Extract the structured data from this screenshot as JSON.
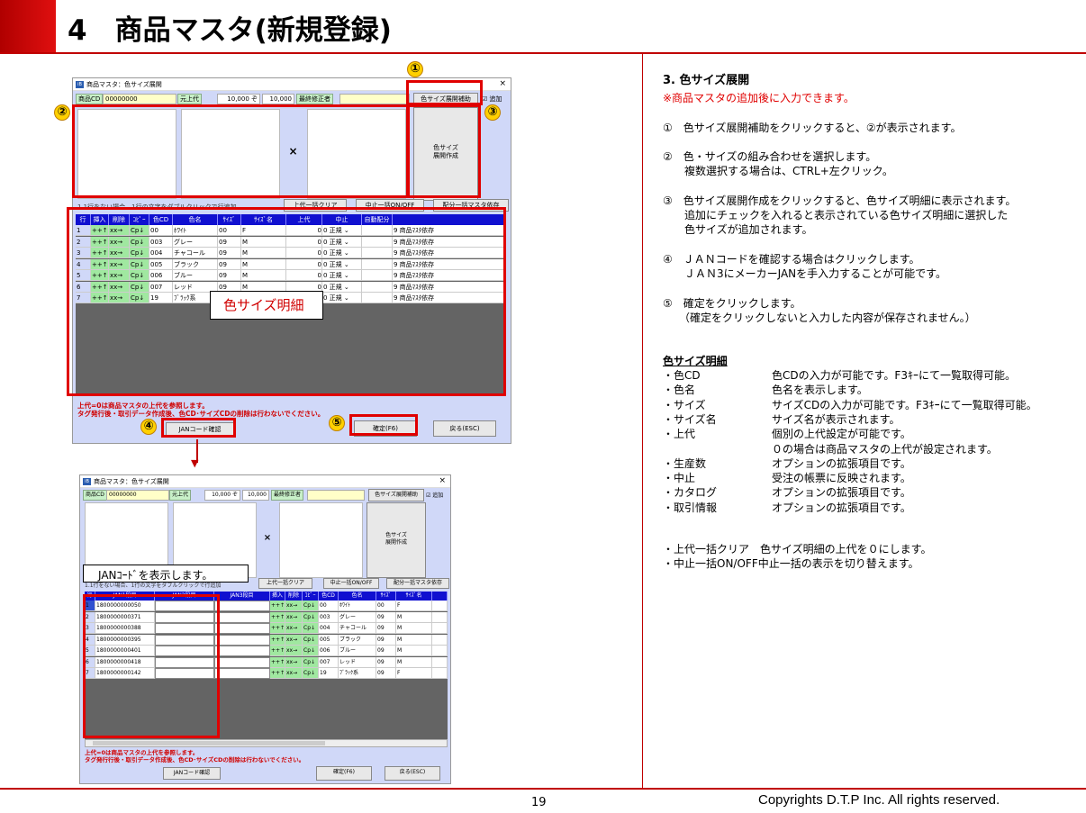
{
  "header": {
    "title": "4　商品マスタ(新規登録)"
  },
  "footer": {
    "page": "19",
    "copyright": "Copyrights  D.T.P Inc. All rights reserved."
  },
  "win1": {
    "title": "商品マスタ：色サイズ展開",
    "close": "×",
    "code_label": "商品CD",
    "code_value": "00000000",
    "price_label": "元上代",
    "price1": "10,000 ぞ",
    "price2": "10,000",
    "editor_label": "最終修正者",
    "expand_help_btn": "色サイズ展開補助",
    "add_check": "☑ 追加",
    "times": "×",
    "create_btn": "色サイズ\n展開作成",
    "hint": "1.1行をない場合、1行の文字をダブルクリックで行追加",
    "clear_btn": "上代一括クリア",
    "toggle_btn": "中止一括ON/OFF",
    "master_btn": "配分一括マスタ依存",
    "headers": [
      "行",
      "挿入",
      "削除",
      "ｺﾋﾟｰ",
      "色CD",
      "色名",
      "ｻｲｽﾞ",
      "ｻｲｽﾞ名",
      "上代",
      "中止",
      "自動配分"
    ],
    "rows": [
      {
        "n": "1",
        "ins": "++↑",
        "del": "xx→",
        "cp": "Cp↓",
        "cd": "00",
        "name": "ﾎﾜｲﾄ",
        "size": "00",
        "sname": "F",
        "price": "0",
        "stop": "0 正規 ⌄",
        "dist": "9 商品ﾏｽﾀ依存"
      },
      {
        "n": "2",
        "ins": "++↑",
        "del": "xx→",
        "cp": "Cp↓",
        "cd": "003",
        "name": "グレー",
        "size": "09",
        "sname": "M",
        "price": "0",
        "stop": "0 正規 ⌄",
        "dist": "9 商品ﾏｽﾀ依存"
      },
      {
        "n": "3",
        "ins": "++↑",
        "del": "xx→",
        "cp": "Cp↓",
        "cd": "004",
        "name": "チャコール",
        "size": "09",
        "sname": "M",
        "price": "0",
        "stop": "0 正規 ⌄",
        "dist": "9 商品ﾏｽﾀ依存"
      },
      {
        "n": "4",
        "ins": "++↑",
        "del": "xx→",
        "cp": "Cp↓",
        "cd": "005",
        "name": "ブラック",
        "size": "09",
        "sname": "M",
        "price": "0",
        "stop": "0 正規 ⌄",
        "dist": "9 商品ﾏｽﾀ依存"
      },
      {
        "n": "5",
        "ins": "++↑",
        "del": "xx→",
        "cp": "Cp↓",
        "cd": "006",
        "name": "ブルー",
        "size": "09",
        "sname": "M",
        "price": "0",
        "stop": "0 正規 ⌄",
        "dist": "9 商品ﾏｽﾀ依存"
      },
      {
        "n": "6",
        "ins": "++↑",
        "del": "xx→",
        "cp": "Cp↓",
        "cd": "007",
        "name": "レッド",
        "size": "09",
        "sname": "M",
        "price": "0",
        "stop": "0 正規 ⌄",
        "dist": "9 商品ﾏｽﾀ依存"
      },
      {
        "n": "7",
        "ins": "++↑",
        "del": "xx→",
        "cp": "Cp↓",
        "cd": "19",
        "name": "ﾌﾞﾗｯｸ系",
        "size": "09",
        "sname": "M",
        "price": "0",
        "stop": "0 正規 ⌄",
        "dist": "9 商品ﾏｽﾀ依存"
      }
    ],
    "grid_note": "色サイズ明細",
    "warn1": "上代=0は商品マスタの上代を参照します。",
    "warn2": "タグ発行後・取引データ作成後、色CD･サイズCDの削除は行わないでください。",
    "jan_btn": "JANコード確認",
    "ok_btn": "確定(F6)",
    "back_btn": "戻る(ESC)"
  },
  "win2": {
    "title": "商品マスタ：色サイズ展開",
    "close": "×",
    "code_label": "商品CD",
    "code_value": "00000000",
    "price_label": "元上代",
    "price1": "10,000 ぞ",
    "price2": "10,000",
    "editor_label": "最終修正者",
    "expand_help_btn": "色サイズ展開補助",
    "add_check": "☑ 追加",
    "times": "×",
    "create_btn": "色サイズ\n展開作成",
    "hint": "1.1行をない場合、1行の文字をダブルクリックで行追加",
    "clear_btn": "上代一括クリア",
    "toggle_btn": "中止一括ON/OFF",
    "master_btn": "配分一括マスタ依存",
    "headers": [
      "行",
      "JAN1段目",
      "JAN2段目",
      "JAN3段目",
      "挿入",
      "削除",
      "ｺﾋﾟｰ",
      "色CD",
      "色名",
      "ｻｲｽﾞ",
      "ｻｲｽﾞ名"
    ],
    "rows": [
      {
        "n": "1",
        "jan": "1800000000050",
        "cd": "00",
        "name": "ﾎﾜｲﾄ",
        "size": "00",
        "sname": "F"
      },
      {
        "n": "2",
        "jan": "1800000000371",
        "cd": "003",
        "name": "グレー",
        "size": "09",
        "sname": "M"
      },
      {
        "n": "3",
        "jan": "1800000000388",
        "cd": "004",
        "name": "チャコール",
        "size": "09",
        "sname": "M"
      },
      {
        "n": "4",
        "jan": "1800000000395",
        "cd": "005",
        "name": "ブラック",
        "size": "09",
        "sname": "M"
      },
      {
        "n": "5",
        "jan": "1800000000401",
        "cd": "006",
        "name": "ブルー",
        "size": "09",
        "sname": "M"
      },
      {
        "n": "6",
        "jan": "1800000000418",
        "cd": "007",
        "name": "レッド",
        "size": "09",
        "sname": "M"
      },
      {
        "n": "7",
        "jan": "1800000000142",
        "cd": "19",
        "name": "ﾌﾞﾗｯｸ系",
        "size": "09",
        "sname": "F"
      }
    ],
    "btn_ins": "++↑",
    "btn_del": "xx→",
    "btn_cp": "Cp↓",
    "note": "JANｺｰﾄﾞを表示します。",
    "warn1": "上代=0は商品マスタの上代を参照します。",
    "warn2": "タグ発行行後・取引データ作成後、色CD･サイズCDの削除は行わないでください。",
    "jan_btn": "JANコード確認",
    "ok_btn": "確定(F6)",
    "back_btn": "戻る(ESC)"
  },
  "markers": {
    "m1": "①",
    "m2": "②",
    "m3": "③",
    "m4": "④",
    "m5": "⑤"
  },
  "arrow": "▼",
  "right": {
    "section_title": "3. 色サイズ展開",
    "section_note": "※商品マスタの追加後に入力できます。",
    "step1": "①　色サイズ展開補助をクリックすると、②が表示されます。",
    "step2a": "②　色・サイズの組み合わせを選択します。",
    "step2b": "　　複数選択する場合は、CTRL+左クリック。",
    "step3a": "③　色サイズ展開作成をクリックすると、色サイズ明細に表示されます。",
    "step3b": "　　追加にチェックを入れると表示されている色サイズ明細に選択した",
    "step3c": "　　色サイズが追加されます。",
    "step4a": "④　ＪＡＮコードを確認する場合はクリックします。",
    "step4b": "　　ＪＡＮ3にメーカーJANを手入力することが可能です。",
    "step5a": "⑤　確定をクリックします。",
    "step5b": "　　（確定をクリックしないと入力した内容が保存されません。）",
    "detail_title": "色サイズ明細",
    "details": [
      {
        "k": "・色CD",
        "v": "色CDの入力が可能です。F3ｷｰにて一覧取得可能。"
      },
      {
        "k": "・色名",
        "v": "色名を表示します。"
      },
      {
        "k": "・サイズ",
        "v": "サイズCDの入力が可能です。F3ｷｰにて一覧取得可能。"
      },
      {
        "k": "・サイズ名",
        "v": "サイズ名が表示されます。"
      },
      {
        "k": "・上代",
        "v": "個別の上代設定が可能です。"
      },
      {
        "k": "",
        "v": "０の場合は商品マスタの上代が設定されます。"
      },
      {
        "k": "・生産数",
        "v": "オプションの拡張項目です。"
      },
      {
        "k": "・中止",
        "v": "受注の帳票に反映されます。"
      },
      {
        "k": "・カタログ",
        "v": "オプションの拡張項目です。"
      },
      {
        "k": "・取引情報",
        "v": "オプションの拡張項目です。"
      }
    ],
    "extra1": "・上代一括クリア　色サイズ明細の上代を０にします。",
    "extra2": "・中止一括ON/OFF中止一括の表示を切り替えます。"
  }
}
